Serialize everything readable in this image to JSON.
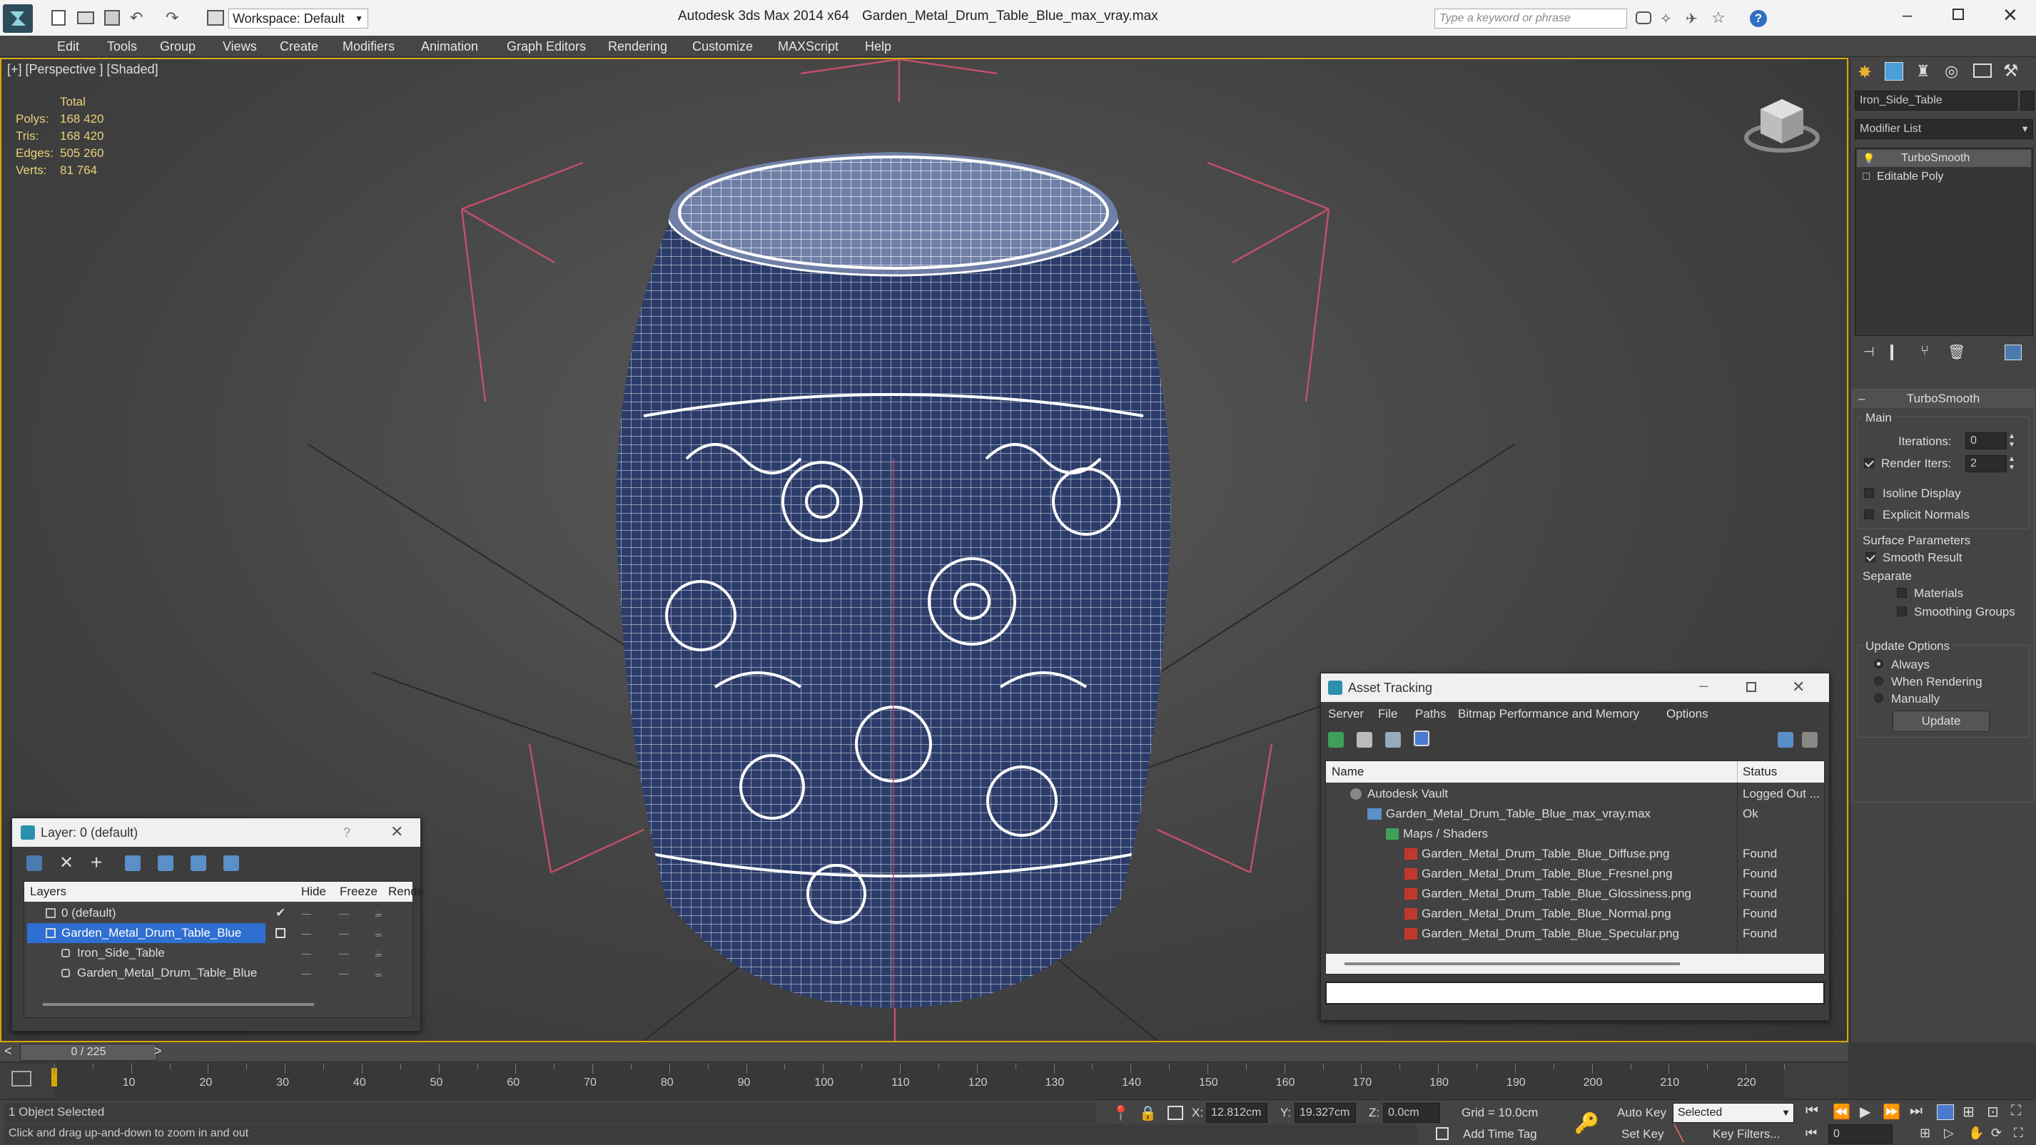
{
  "titlebar": {
    "workspace": "Workspace: Default",
    "app_title": "Autodesk 3ds Max  2014 x64",
    "file_title": "Garden_Metal_Drum_Table_Blue_max_vray.max",
    "search_placeholder": "Type a keyword or phrase"
  },
  "menu": [
    "Edit",
    "Tools",
    "Group",
    "Views",
    "Create",
    "Modifiers",
    "Animation",
    "Graph Editors",
    "Rendering",
    "Customize",
    "MAXScript",
    "Help"
  ],
  "viewport": {
    "label": "[+] [Perspective ] [Shaded]",
    "stats": {
      "header": "Total",
      "rows": [
        {
          "label": "Polys:",
          "value": "168 420"
        },
        {
          "label": "Tris:",
          "value": "168 420"
        },
        {
          "label": "Edges:",
          "value": "505 260"
        },
        {
          "label": "Verts:",
          "value": "81 764"
        }
      ]
    }
  },
  "command_panel": {
    "object_name": "Iron_Side_Table",
    "modifier_list": "Modifier List",
    "stack": [
      "TurboSmooth",
      "Editable Poly"
    ],
    "rollout_title": "TurboSmooth",
    "main_label": "Main",
    "iterations_label": "Iterations:",
    "iterations_value": "0",
    "render_iters_label": "Render Iters:",
    "render_iters_value": "2",
    "isoline": "Isoline Display",
    "explicit": "Explicit Normals",
    "surface_params": "Surface Parameters",
    "smooth_result": "Smooth Result",
    "separate": "Separate",
    "materials": "Materials",
    "smoothing_groups": "Smoothing Groups",
    "update_options": "Update Options",
    "always": "Always",
    "when_rendering": "When Rendering",
    "manually": "Manually",
    "update_button": "Update"
  },
  "layer_window": {
    "title": "Layer: 0 (default)",
    "help": "?",
    "columns": {
      "layers": "Layers",
      "hide": "Hide",
      "freeze": "Freeze",
      "render": "Rende"
    },
    "rows": [
      "0 (default)",
      "Garden_Metal_Drum_Table_Blue",
      "Iron_Side_Table",
      "Garden_Metal_Drum_Table_Blue"
    ]
  },
  "asset_window": {
    "title": "Asset Tracking",
    "menu": [
      "Server",
      "File",
      "Paths",
      "Bitmap Performance and Memory",
      "Options"
    ],
    "columns": {
      "name": "Name",
      "status": "Status"
    },
    "rows": [
      {
        "name": "Autodesk Vault",
        "status": "Logged Out ..."
      },
      {
        "name": "Garden_Metal_Drum_Table_Blue_max_vray.max",
        "status": "Ok"
      },
      {
        "name": "Maps / Shaders",
        "status": ""
      },
      {
        "name": "Garden_Metal_Drum_Table_Blue_Diffuse.png",
        "status": "Found"
      },
      {
        "name": "Garden_Metal_Drum_Table_Blue_Fresnel.png",
        "status": "Found"
      },
      {
        "name": "Garden_Metal_Drum_Table_Blue_Glossiness.png",
        "status": "Found"
      },
      {
        "name": "Garden_Metal_Drum_Table_Blue_Normal.png",
        "status": "Found"
      },
      {
        "name": "Garden_Metal_Drum_Table_Blue_Specular.png",
        "status": "Found"
      }
    ]
  },
  "timeline": {
    "frame_counter": "0 / 225",
    "ticks": [
      "10",
      "20",
      "30",
      "40",
      "50",
      "60",
      "70",
      "80",
      "90",
      "100",
      "110",
      "120",
      "130",
      "140",
      "150",
      "160",
      "170",
      "180",
      "190",
      "200",
      "210",
      "220"
    ]
  },
  "status": {
    "selection": "1 Object Selected",
    "prompt": "Click and drag up-and-down to zoom in and out",
    "x_label": "X:",
    "x_value": "12.812cm",
    "y_label": "Y:",
    "y_value": "19.327cm",
    "z_label": "Z:",
    "z_value": "0.0cm",
    "grid": "Grid = 10.0cm",
    "add_time_tag": "Add Time Tag",
    "auto_key": "Auto Key",
    "set_key": "Set Key",
    "selected": "Selected",
    "key_filters": "Key Filters...",
    "frame_value": "0"
  },
  "colors": {
    "accent_yellow": "#d6a800",
    "selection_blue": "#2f6fd1",
    "stats_yellow": "#e8d27a"
  }
}
